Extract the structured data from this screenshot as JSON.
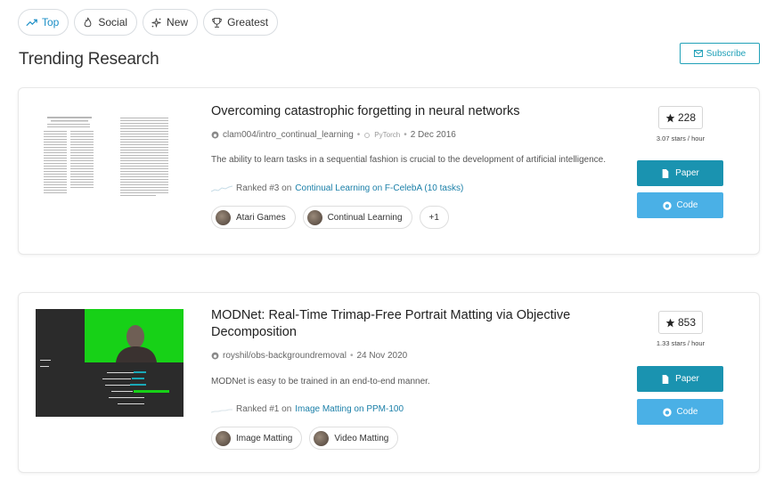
{
  "filters": [
    {
      "label": "Top",
      "icon": "trending-icon",
      "active": true
    },
    {
      "label": "Social",
      "icon": "flame-icon",
      "active": false
    },
    {
      "label": "New",
      "icon": "sparkle-icon",
      "active": false
    },
    {
      "label": "Greatest",
      "icon": "trophy-icon",
      "active": false
    }
  ],
  "heading": "Trending Research",
  "subscribe_label": "Subscribe",
  "papers": [
    {
      "title": "Overcoming catastrophic forgetting in neural networks",
      "repo": "clam004/intro_continual_learning",
      "framework": "PyTorch",
      "date": "2 Dec 2016",
      "abstract": "The ability to learn tasks in a sequential fashion is crucial to the development of artificial intelligence.",
      "ranked_prefix": "Ranked #3 on",
      "ranked_link": "Continual Learning on F-CelebA (10 tasks)",
      "tags": [
        "Atari Games",
        "Continual Learning",
        "+1"
      ],
      "stars": "228",
      "rate": "3.07 stars / hour",
      "paper_label": "Paper",
      "code_label": "Code"
    },
    {
      "title": "MODNet: Real-Time Trimap-Free Portrait Matting via Objective Decomposition",
      "repo": "royshil/obs-backgroundremoval",
      "date": "24 Nov 2020",
      "abstract": "MODNet is easy to be trained in an end-to-end manner.",
      "ranked_prefix": "Ranked #1 on",
      "ranked_link": "Image Matting on PPM-100",
      "tags": [
        "Image Matting",
        "Video Matting"
      ],
      "stars": "853",
      "rate": "1.33 stars / hour",
      "paper_label": "Paper",
      "code_label": "Code"
    }
  ],
  "colors": {
    "accent": "#1a8ec6",
    "paper_button": "#1a93b0",
    "code_button": "#4ab0e6",
    "link": "#1a7fa8"
  }
}
